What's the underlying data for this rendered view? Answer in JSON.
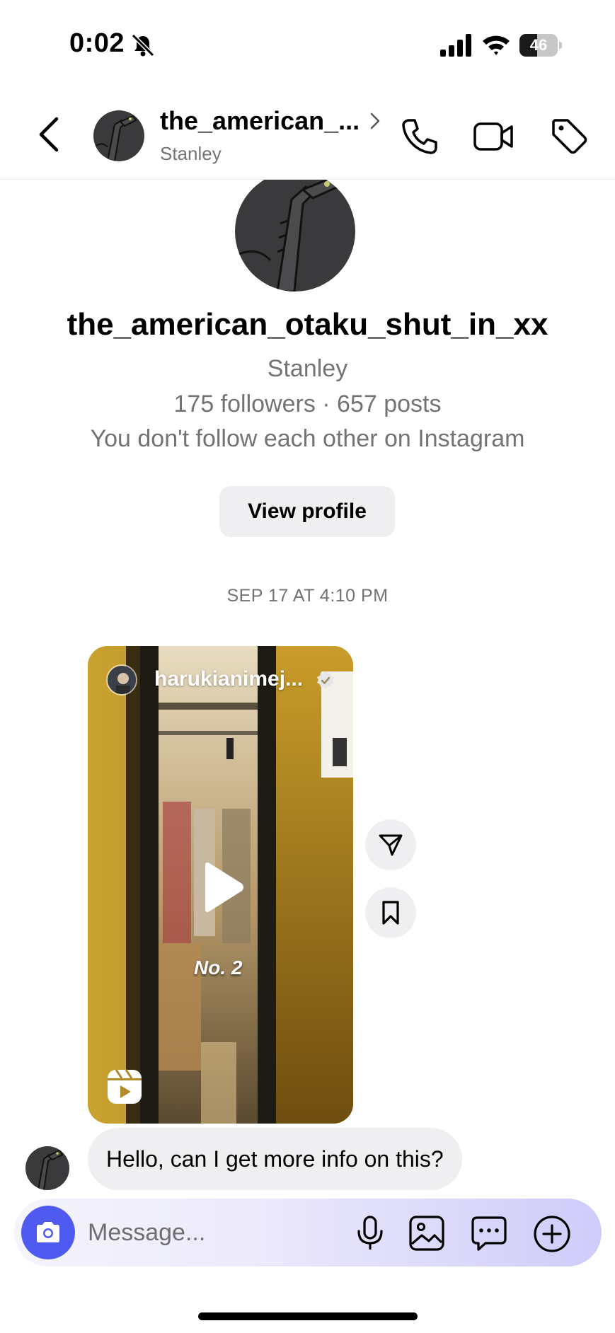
{
  "status_bar": {
    "time": "0:02",
    "battery_level": "46",
    "battery_fraction": 0.46
  },
  "header": {
    "username": "the_american_...",
    "full_name": "Stanley"
  },
  "profile": {
    "username": "the_american_otaku_shut_in_xx",
    "full_name": "Stanley",
    "stats": "175 followers · 657 posts",
    "follow_status": "You don't follow each other on Instagram",
    "view_profile_label": "View profile"
  },
  "conversation": {
    "timestamp": "SEP 17 AT 4:10 PM",
    "reel": {
      "owner": "harukianimej...",
      "caption": "No. 2"
    },
    "message": "Hello, can I get more info on this?"
  },
  "composer": {
    "placeholder": "Message..."
  },
  "icons": {
    "status": [
      "bell-slash-icon",
      "cellular-signal-icon",
      "wifi-icon",
      "battery-icon"
    ],
    "header": [
      "back-chevron-icon",
      "chevron-right-icon",
      "phone-icon",
      "video-camera-icon",
      "tag-icon"
    ],
    "reel": [
      "verified-badge-icon",
      "play-icon",
      "reels-icon"
    ],
    "actions": [
      "send-icon",
      "bookmark-icon"
    ],
    "composer": [
      "camera-icon",
      "microphone-icon",
      "image-icon",
      "sticker-chat-icon",
      "plus-circle-icon"
    ]
  },
  "colors": {
    "accent": "#4f5bf0",
    "secondary_text": "#737373",
    "bubble": "#efeff1"
  }
}
